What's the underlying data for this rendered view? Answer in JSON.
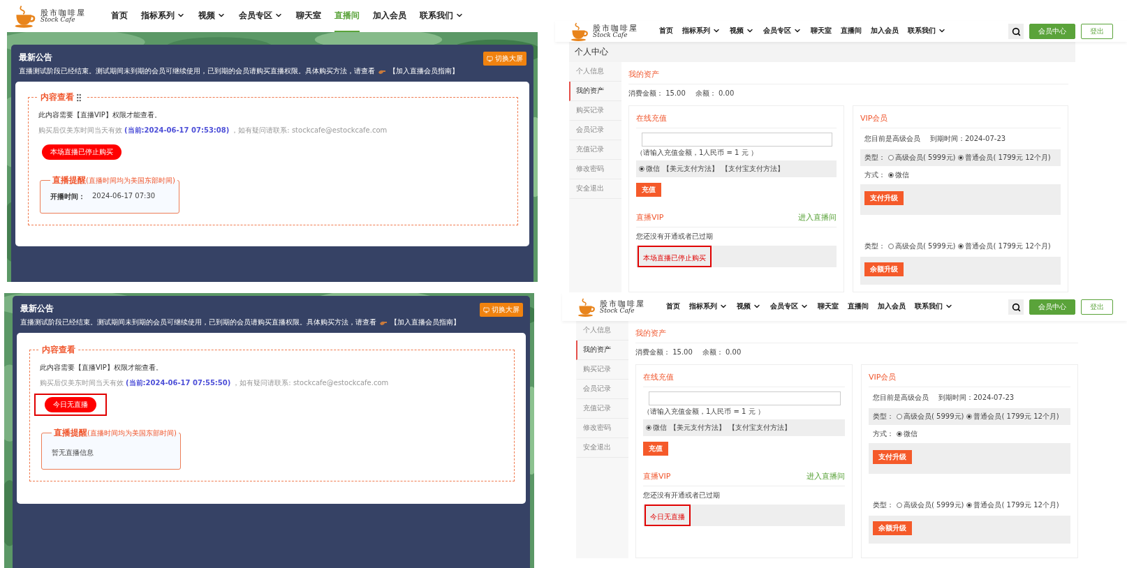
{
  "panels": [
    {
      "kind": "live",
      "nav": {
        "logo": "股市咖啡屋",
        "logo_sub": "Stock Cafe",
        "items": [
          {
            "label": "首页",
            "dropdown": false,
            "selected": false
          },
          {
            "label": "指标系列",
            "dropdown": true,
            "selected": false
          },
          {
            "label": "视频",
            "dropdown": true,
            "selected": false
          },
          {
            "label": "会员专区",
            "dropdown": true,
            "selected": false
          },
          {
            "label": "聊天室",
            "dropdown": false,
            "selected": false
          },
          {
            "label": "直播间",
            "dropdown": false,
            "selected": true
          },
          {
            "label": "加入会员",
            "dropdown": false,
            "selected": false
          },
          {
            "label": "联系我们",
            "dropdown": true,
            "selected": false
          }
        ]
      },
      "notice": {
        "title": "最新公告",
        "text": "直播测试阶段已经结束。测试期间未到期的会员可继续使用，已到期的会员请购买直播权限。具体购买方法，请查看",
        "link": "【加入直播会员指南】",
        "button": "切换大屏"
      },
      "content": {
        "legend": "内容查看",
        "message": "此内容需要【直播VIP】权限才能查看。",
        "hint": "购买后仅美东时间当天有效",
        "current": "(当前:2024-06-17 07:53:08)",
        "contact": "，如有疑问请联系: stockcafe@estockcafe.com",
        "action": "本场直播已停止购买",
        "highlighted": false,
        "grip": true,
        "reminder": {
          "title": "直播提醒",
          "note": "(直播时间均为美国东部时间)",
          "label": "开播时间：",
          "value": "2024-06-17 07:30"
        }
      }
    },
    {
      "kind": "account",
      "nav": {
        "logo": "股市咖啡屋",
        "logo_sub": "Stock Cafe",
        "items": [
          {
            "label": "首页",
            "dropdown": false,
            "selected": false
          },
          {
            "label": "指标系列",
            "dropdown": true,
            "selected": false
          },
          {
            "label": "视频",
            "dropdown": true,
            "selected": false
          },
          {
            "label": "会员专区",
            "dropdown": true,
            "selected": false
          },
          {
            "label": "聊天室",
            "dropdown": false,
            "selected": false
          },
          {
            "label": "直播间",
            "dropdown": false,
            "selected": false
          },
          {
            "label": "加入会员",
            "dropdown": false,
            "selected": false
          },
          {
            "label": "联系我们",
            "dropdown": true,
            "selected": false
          }
        ],
        "member_button": "会员中心",
        "logout_button": "登出"
      },
      "header": "个人中心",
      "sidebar": [
        {
          "label": "个人信息",
          "selected": false
        },
        {
          "label": "我的资产",
          "selected": true
        },
        {
          "label": "购买记录",
          "selected": false
        },
        {
          "label": "会员记录",
          "selected": false
        },
        {
          "label": "充值记录",
          "selected": false
        },
        {
          "label": "修改密码",
          "selected": false
        },
        {
          "label": "安全退出",
          "selected": false
        }
      ],
      "assets": {
        "title": "我的资产",
        "spend": "消费金额： 15.00",
        "balance": "余额： 0.00"
      },
      "recharge": {
        "title": "在线充值",
        "hint": "（请输入充值金额，1人民币 = 1 元 ）",
        "payment": {
          "label": "微信",
          "selected": true
        },
        "links": [
          "【美元支付方法】",
          "【支付宝支付方法】"
        ],
        "button": "充值"
      },
      "live_vip": {
        "title": "直播VIP",
        "link": "进入直播间",
        "status": "您还没有开通或者已过期",
        "action": "本场直播已停止购买",
        "highlighted": true
      },
      "vip": {
        "title": "VIP会员",
        "status": "您目前是高级会员",
        "expiry": "到期时间：2024-07-23",
        "type_label": "类型：",
        "types": [
          {
            "label": "高级会员( 5999元)",
            "selected": false
          },
          {
            "label": "普通会员( 1799元 12个月)",
            "selected": true
          }
        ],
        "method_label": "方式：",
        "methods": [
          {
            "label": "微信",
            "selected": true
          }
        ],
        "pay_button": "支付升级",
        "type_label_2": "类型：",
        "types_2": [
          {
            "label": "高级会员( 5999元)",
            "selected": false
          },
          {
            "label": "普通会员( 1799元 12个月)",
            "selected": true
          }
        ],
        "balance_button": "余额升级"
      }
    },
    {
      "kind": "live",
      "notice": {
        "title": "最新公告",
        "text": "直播测试阶段已经结束。测试期间未到期的会员可继续使用，已到期的会员请购买直播权限。具体购买方法，请查看",
        "link": "【加入直播会员指南】",
        "button": "切换大屏"
      },
      "content": {
        "legend": "内容查看",
        "message": "此内容需要【直播VIP】权限才能查看。",
        "hint": "购买后仅美东时间当天有效",
        "current": "(当前:2024-06-17 07:55:50)",
        "contact": "，如有疑问请联系: stockcafe@estockcafe.com",
        "action": "今日无直播",
        "highlighted": true,
        "grip": false,
        "reminder": {
          "title": "直播提醒",
          "note": "(直播时间均为美国东部时间)",
          "empty": "暂无直播信息"
        }
      }
    },
    {
      "kind": "account",
      "nav": {
        "logo": "股市咖啡屋",
        "logo_sub": "Stock Cafe",
        "items": [
          {
            "label": "首页",
            "dropdown": false,
            "selected": false
          },
          {
            "label": "指标系列",
            "dropdown": true,
            "selected": false
          },
          {
            "label": "视频",
            "dropdown": true,
            "selected": false
          },
          {
            "label": "会员专区",
            "dropdown": true,
            "selected": false
          },
          {
            "label": "聊天室",
            "dropdown": false,
            "selected": false
          },
          {
            "label": "直播间",
            "dropdown": false,
            "selected": false
          },
          {
            "label": "加入会员",
            "dropdown": false,
            "selected": false
          },
          {
            "label": "联系我们",
            "dropdown": true,
            "selected": false
          }
        ],
        "member_button": "会员中心",
        "logout_button": "登出"
      },
      "sidebar": [
        {
          "label": "个人信息",
          "selected": false
        },
        {
          "label": "我的资产",
          "selected": true
        },
        {
          "label": "购买记录",
          "selected": false
        },
        {
          "label": "会员记录",
          "selected": false
        },
        {
          "label": "充值记录",
          "selected": false
        },
        {
          "label": "修改密码",
          "selected": false
        },
        {
          "label": "安全退出",
          "selected": false
        }
      ],
      "assets": {
        "title": "我的资产",
        "spend": "消费金额： 15.00",
        "balance": "余额： 0.00"
      },
      "recharge": {
        "title": "在线充值",
        "hint": "（请输入充值金额，1人民币 = 1 元 ）",
        "payment": {
          "label": "微信",
          "selected": true
        },
        "links": [
          "【美元支付方法】",
          "【支付宝支付方法】"
        ],
        "button": "充值"
      },
      "live_vip": {
        "title": "直播VIP",
        "link": "进入直播间",
        "status": "您还没有开通或者已过期",
        "action": "今日无直播",
        "highlighted": true
      },
      "vip": {
        "title": "VIP会员",
        "status": "您目前是高级会员",
        "expiry": "到期时间：2024-07-23",
        "type_label": "类型：",
        "types": [
          {
            "label": "高级会员( 5999元)",
            "selected": false
          },
          {
            "label": "普通会员( 1799元 12个月)",
            "selected": true
          }
        ],
        "method_label": "方式：",
        "methods": [
          {
            "label": "微信",
            "selected": true
          }
        ],
        "pay_button": "支付升级",
        "type_label_2": "类型：",
        "types_2": [
          {
            "label": "高级会员( 5999元)",
            "selected": false
          },
          {
            "label": "普通会员( 1799元 12个月)",
            "selected": true
          }
        ],
        "balance_button": "余额升级"
      }
    }
  ]
}
